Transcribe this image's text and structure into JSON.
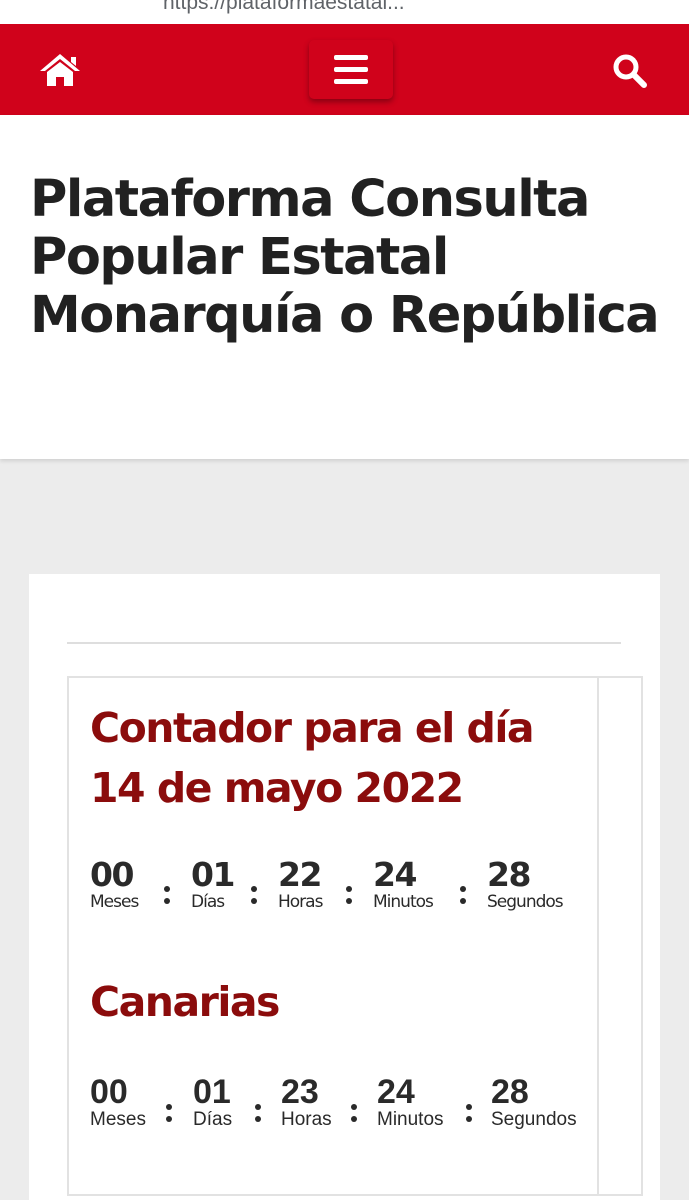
{
  "browser": {
    "url_text": "https://plataformaestatal..."
  },
  "navbar": {
    "home_icon": "home-icon",
    "menu_icon": "hamburger-menu-icon",
    "search_icon": "search-icon",
    "background_color": "#d0021b"
  },
  "site": {
    "title": "Plataforma Consulta Popular Estatal Monarquía o República"
  },
  "countdown_main": {
    "heading": "Contador para el día 14 de mayo 2022",
    "heading_color": "#8b0c0c",
    "units": [
      {
        "value": "00",
        "label": "Meses"
      },
      {
        "value": "01",
        "label": "Días"
      },
      {
        "value": "22",
        "label": "Horas"
      },
      {
        "value": "24",
        "label": "Minutos"
      },
      {
        "value": "28",
        "label": "Segundos"
      }
    ]
  },
  "countdown_canarias": {
    "heading": "Canarias",
    "units": [
      {
        "value": "00",
        "label": "Meses"
      },
      {
        "value": "01",
        "label": "Días"
      },
      {
        "value": "23",
        "label": "Horas"
      },
      {
        "value": "24",
        "label": "Minutos"
      },
      {
        "value": "28",
        "label": "Segundos"
      }
    ]
  }
}
